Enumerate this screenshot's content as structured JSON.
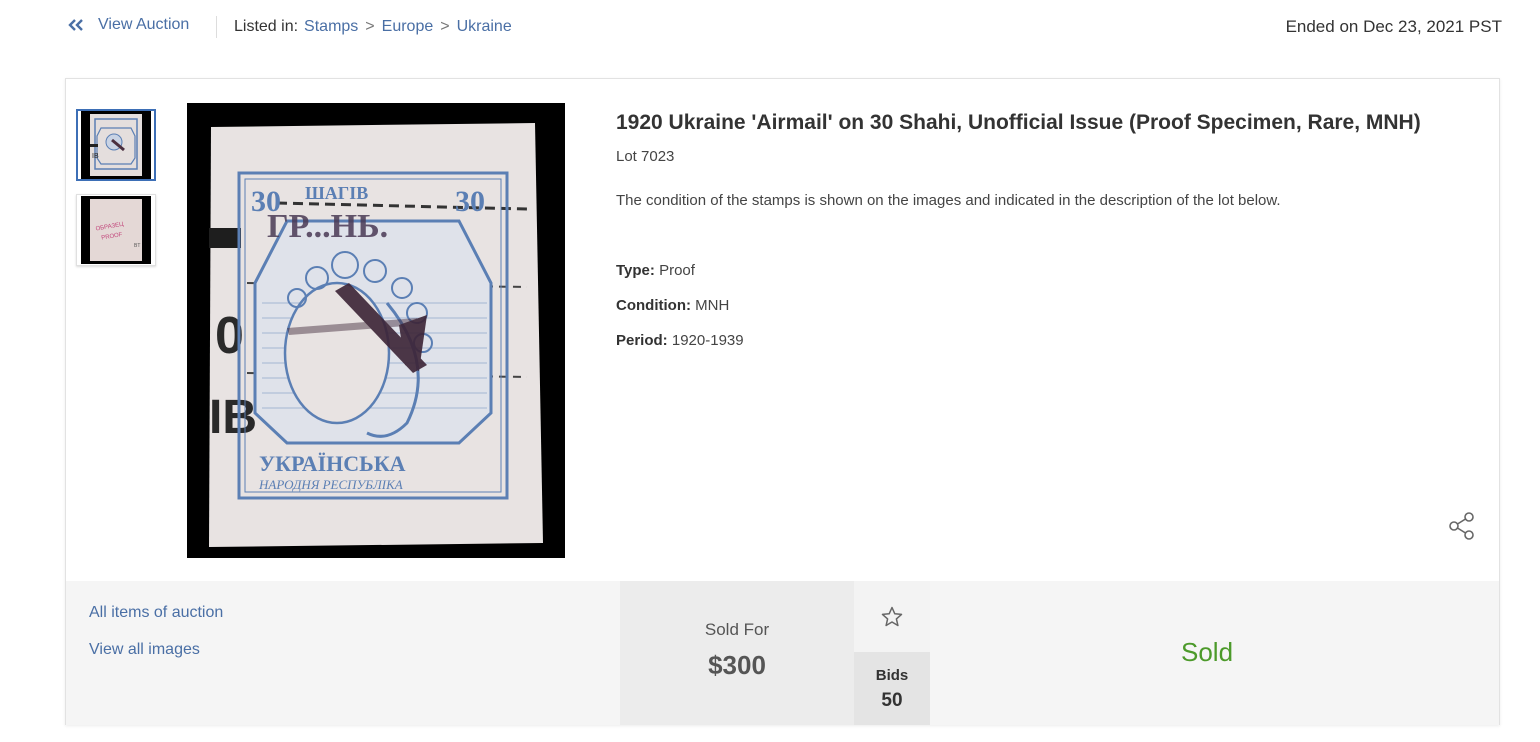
{
  "nav": {
    "back_label": "View Auction",
    "listed_in_label": "Listed in:",
    "breadcrumbs": [
      "Stamps",
      "Europe",
      "Ukraine"
    ],
    "breadcrumb_separator": ">",
    "ended_text": "Ended on Dec 23, 2021 PST"
  },
  "item": {
    "title": "1920 Ukraine 'Airmail' on 30 Shahi, Unofficial Issue (Proof Specimen, Rare, MNH)",
    "lot": "Lot 7023",
    "description": "The condition of the stamps is shown on the images and indicated in the description of the lot below.",
    "attributes": [
      {
        "label": "Type:",
        "value": "Proof"
      },
      {
        "label": "Condition:",
        "value": "MNH"
      },
      {
        "label": "Period:",
        "value": "1920-1939"
      }
    ],
    "stamp": {
      "top_text": "ШАГІВ",
      "denomination": "30",
      "overprint": "ГР...НЬ.",
      "bottom_text": "УКРАЇНСЬКА",
      "sub_text": "НАРОДНЯ РЕСПУБЛІКА"
    },
    "thumbnails": [
      "stamp-front",
      "stamp-proof"
    ],
    "thumbnail_proof_text": [
      "ОБРАЗЕЦ",
      "PROOF"
    ]
  },
  "bottom": {
    "links": [
      "All items of auction",
      "View all images"
    ],
    "sold_for_label": "Sold For",
    "price": "$300",
    "bids_label": "Bids",
    "bids_count": "50",
    "status": "Sold"
  },
  "colors": {
    "link": "#4a6fa5",
    "accent_border": "#3d6fb6",
    "status_green": "#4c9a2a",
    "stamp_blue": "#5b7fb4",
    "stamp_paper": "#e8e3e2"
  },
  "icons": {
    "back": "double-chevron-left-icon",
    "share": "share-icon",
    "watch": "star-icon"
  }
}
